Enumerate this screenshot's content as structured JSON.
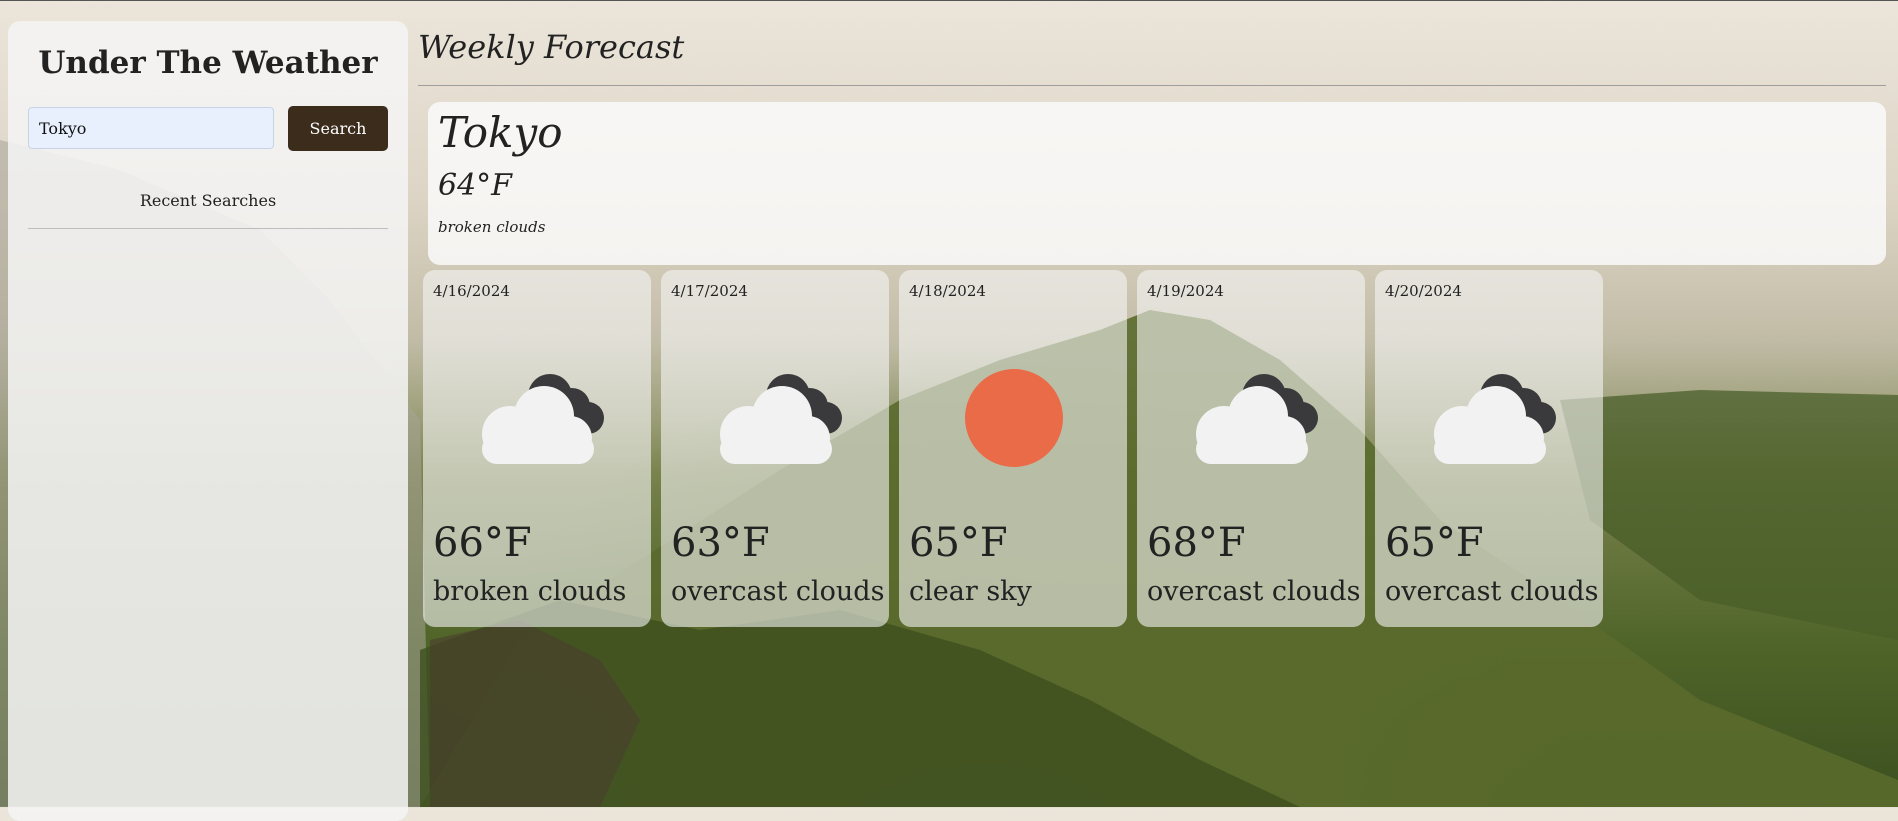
{
  "sidebar": {
    "title": "Under The Weather",
    "search_value": "Tokyo",
    "search_button": "Search",
    "recent_title": "Recent Searches"
  },
  "main": {
    "heading": "Weekly Forecast",
    "today": {
      "city": "Tokyo",
      "temp": "64°F",
      "description": "broken clouds"
    },
    "forecast": [
      {
        "date": "4/16/2024",
        "temp": "66°F",
        "description": "broken clouds",
        "icon": "cloud-icon"
      },
      {
        "date": "4/17/2024",
        "temp": "63°F",
        "description": "overcast clouds",
        "icon": "cloud-icon"
      },
      {
        "date": "4/18/2024",
        "temp": "65°F",
        "description": "clear sky",
        "icon": "sun-icon"
      },
      {
        "date": "4/19/2024",
        "temp": "68°F",
        "description": "overcast clouds",
        "icon": "cloud-icon"
      },
      {
        "date": "4/20/2024",
        "temp": "65°F",
        "description": "overcast clouds",
        "icon": "cloud-icon"
      }
    ]
  },
  "colors": {
    "search_button": "#3b2c1c",
    "sun": "#ea6b48",
    "dark_cloud": "#3a3a3c",
    "light_cloud": "#f2f2f2"
  }
}
